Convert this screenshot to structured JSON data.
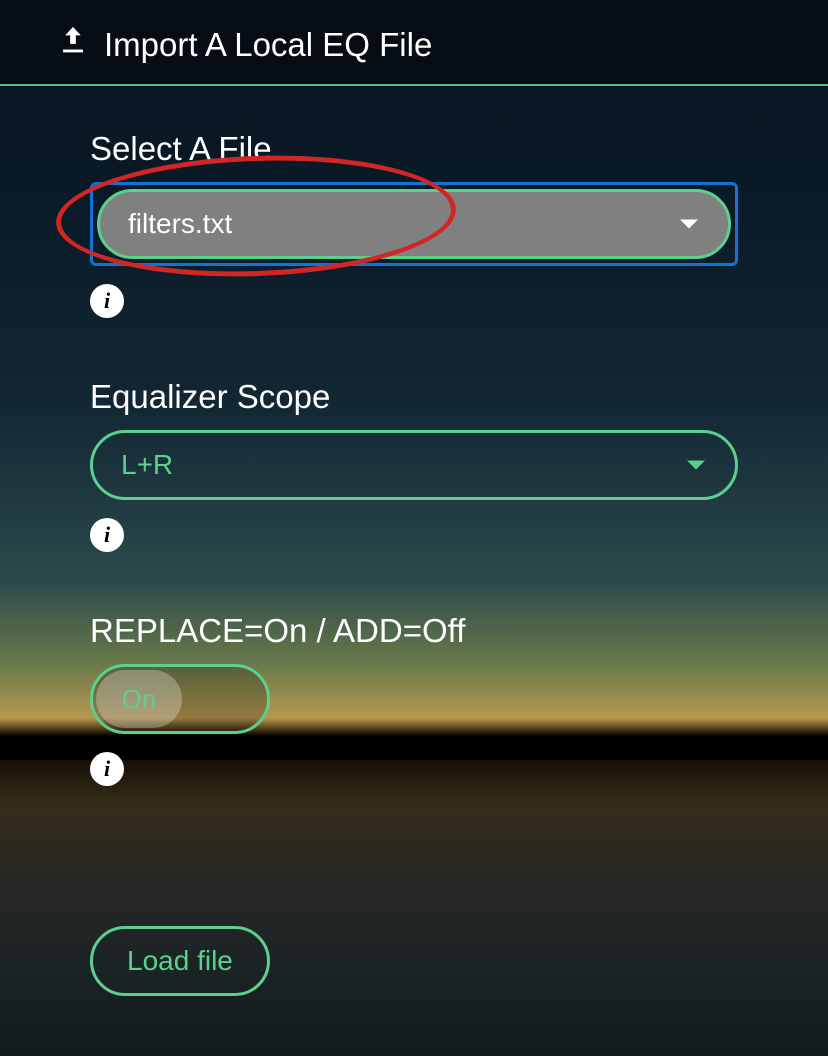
{
  "header": {
    "title": "Import A Local EQ File"
  },
  "file": {
    "label": "Select A File",
    "value": "filters.txt"
  },
  "scope": {
    "label": "Equalizer Scope",
    "value": "L+R"
  },
  "mode": {
    "label": "REPLACE=On / ADD=Off",
    "value": "On"
  },
  "actions": {
    "load": "Load file"
  },
  "colors": {
    "accent": "#5bd08f",
    "focus": "#1173d4",
    "annotation": "#d22525"
  }
}
